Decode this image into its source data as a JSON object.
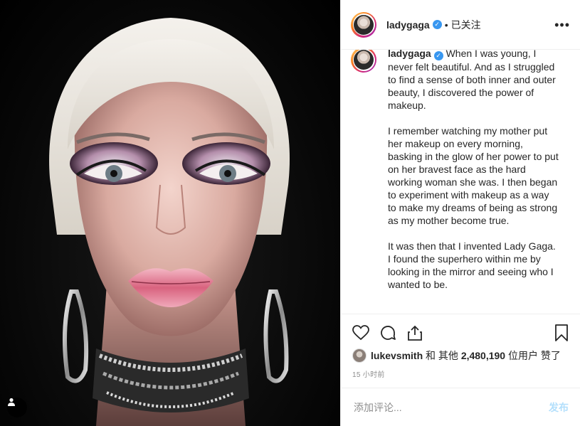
{
  "header": {
    "username": "ladygaga",
    "separator": "•",
    "follow_status": "已关注",
    "more": "•••"
  },
  "caption": {
    "username": "ladygaga",
    "paragraphs": [
      "When I was young, I never felt beautiful. And as I struggled to find a sense of both inner and outer beauty, I discovered the power of makeup.",
      "I remember watching my mother put her makeup on every morning, basking in the glow of her power to put on her bravest face as the hard working woman she was. I then began to experiment with makeup as a way to make my dreams of being as strong as my mother become true.",
      "It was then that I invented Lady Gaga. I found the superhero within me by looking in the mirror and seeing who I wanted to be."
    ]
  },
  "actions": {
    "icons": [
      "heart-icon",
      "comment-icon",
      "share-icon",
      "bookmark-icon"
    ]
  },
  "likes": {
    "user": "lukevsmith",
    "and_others": "和 其他",
    "count": "2,480,190",
    "suffix": "位用户 赞了"
  },
  "timestamp": "15 小时前",
  "comment": {
    "placeholder": "添加评论...",
    "post_label": "发布"
  },
  "colors": {
    "verified": "#3897f0",
    "post_button": "#b2dffc",
    "muted": "#8e8e8e",
    "text": "#262626"
  }
}
